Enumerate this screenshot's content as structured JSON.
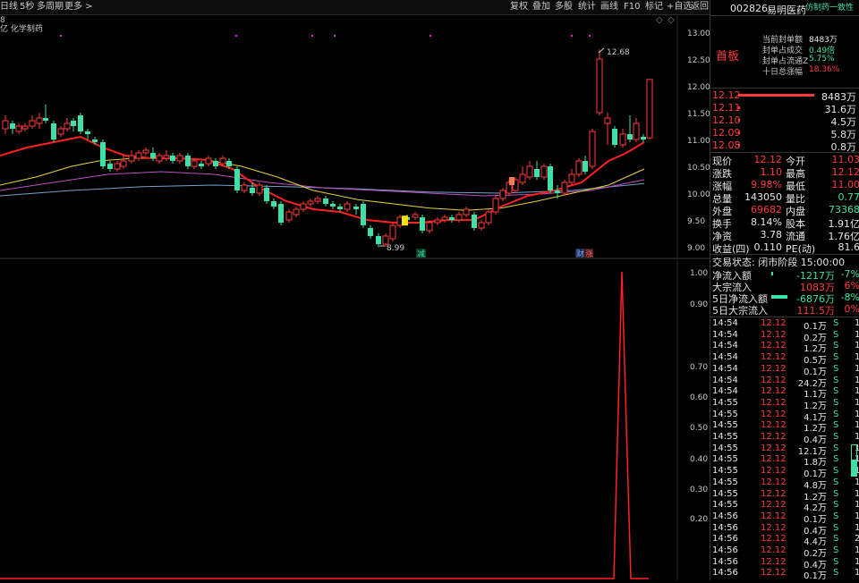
{
  "toolbar": {
    "left": [
      {
        "name": "period-daily",
        "label": "日线"
      },
      {
        "name": "period-5s",
        "label": "5秒"
      },
      {
        "name": "multi-period",
        "label": "多周期"
      },
      {
        "name": "more",
        "label": "更多 >"
      }
    ],
    "right": [
      {
        "name": "restore-rights",
        "label": "复权"
      },
      {
        "name": "overlay",
        "label": "叠加"
      },
      {
        "name": "multi-stock",
        "label": "多股"
      },
      {
        "name": "stats",
        "label": "统计"
      },
      {
        "name": "draw-line",
        "label": "画线"
      },
      {
        "name": "f10",
        "label": "F10"
      },
      {
        "name": "mark",
        "label": "标记"
      },
      {
        "name": "add-watch",
        "label": "+自选"
      },
      {
        "name": "back",
        "label": "返回"
      }
    ]
  },
  "chart": {
    "indicator_num": "8",
    "sector_label": "亿 化学制药",
    "y_labels": [
      "13.00",
      "12.50",
      "12.00",
      "11.50",
      "11.00",
      "10.50",
      "10.00",
      "9.50",
      "9.00"
    ],
    "high_label": "12.68",
    "low_label": "8.99",
    "event_labels": [
      "减",
      "财",
      "涨"
    ],
    "lower_y_labels": [
      "1.00",
      "0.90",
      "0.70",
      "0.60",
      "0.50",
      "0.40",
      "0.30",
      "0.20"
    ]
  },
  "panel": {
    "code": "002826",
    "name": "易明医药",
    "tag": "仿制药一致性",
    "status": "首板",
    "seal_stats": [
      {
        "label": "当前封单额",
        "value": "8483万",
        "color": "white"
      },
      {
        "label": "封单占成交",
        "value": "0.49倍",
        "color": "green"
      },
      {
        "label": "封单占流通Z",
        "value": "5.75%",
        "color": "green"
      },
      {
        "label": "十日总涨幅",
        "value": "18.36%",
        "color": "red"
      }
    ],
    "bids": [
      {
        "price": "12.12",
        "vol": "8483万",
        "bar": 1.0
      },
      {
        "price": "12.11",
        "vol": "31.6万",
        "bar": 0.02
      },
      {
        "price": "12.10",
        "vol": "4.5万",
        "bar": 0.02
      },
      {
        "price": "12.09",
        "vol": "5.8万",
        "bar": 0.02
      },
      {
        "price": "12.08",
        "vol": "0.8万",
        "bar": 0.02
      }
    ],
    "quote_rows": [
      {
        "l1": "现价",
        "v1": "12.12",
        "c1": "red",
        "l2": "今开",
        "v2": "11.03",
        "c2": "red"
      },
      {
        "l1": "涨跌",
        "v1": "1.10",
        "c1": "red",
        "l2": "最高",
        "v2": "12.12",
        "c2": "red"
      },
      {
        "l1": "涨幅",
        "v1": "9.98%",
        "c1": "red",
        "l2": "最低",
        "v2": "11.00",
        "c2": "red"
      },
      {
        "l1": "总量",
        "v1": "143050",
        "c1": "white",
        "l2": "量比",
        "v2": "0.77",
        "c2": "green"
      },
      {
        "l1": "外盘",
        "v1": "69682",
        "c1": "red",
        "l2": "内盘",
        "v2": "73368",
        "c2": "green"
      },
      {
        "l1": "换手",
        "v1": "8.14%",
        "c1": "white",
        "l2": "股本",
        "v2": "1.91亿",
        "c2": "white"
      },
      {
        "l1": "净资",
        "v1": "3.78",
        "c1": "white",
        "l2": "流通",
        "v2": "1.76亿",
        "c2": "white"
      },
      {
        "l1": "收益(四)",
        "v1": "0.110",
        "c1": "white",
        "l2": "PE(动)",
        "v2": "81.6",
        "c2": "white"
      }
    ],
    "trade_status": "交易状态: 闭市阶段 15:00:00",
    "flows": [
      {
        "label": "净流入额",
        "value": "-1217万",
        "pct": "-7%",
        "color": "green",
        "bar": 0.03
      },
      {
        "label": "大宗流入",
        "value": "1083万",
        "pct": "6%",
        "color": "red",
        "bar": 0
      },
      {
        "label": "5日净流入额",
        "value": "-6876万",
        "pct": "-8%",
        "color": "green",
        "bar": 0.9
      },
      {
        "label": "5日大宗流入",
        "value": "111.5万",
        "pct": "0%",
        "color": "red",
        "bar": 0
      }
    ],
    "ticks": [
      {
        "time": "14:54",
        "price": "12.12",
        "vol": "0.1万",
        "side": "S",
        "n": "1"
      },
      {
        "time": "14:54",
        "price": "12.12",
        "vol": "0.2万",
        "side": "S",
        "n": "1"
      },
      {
        "time": "14:54",
        "price": "12.12",
        "vol": "1.2万",
        "side": "S",
        "n": "1"
      },
      {
        "time": "14:54",
        "price": "12.12",
        "vol": "0.5万",
        "side": "S",
        "n": "1"
      },
      {
        "time": "14:54",
        "price": "12.12",
        "vol": "0.1万",
        "side": "S",
        "n": "1"
      },
      {
        "time": "14:54",
        "price": "12.12",
        "vol": "24.2万",
        "side": "S",
        "n": "1"
      },
      {
        "time": "14:54",
        "price": "12.12",
        "vol": "1.1万",
        "side": "S",
        "n": "1"
      },
      {
        "time": "14:55",
        "price": "12.12",
        "vol": "1.2万",
        "side": "S",
        "n": "1"
      },
      {
        "time": "14:55",
        "price": "12.12",
        "vol": "4.1万",
        "side": "S",
        "n": "1"
      },
      {
        "time": "14:55",
        "price": "12.12",
        "vol": "1.2万",
        "side": "S",
        "n": "1"
      },
      {
        "time": "14:55",
        "price": "12.12",
        "vol": "0.4万",
        "side": "S",
        "n": "1"
      },
      {
        "time": "14:55",
        "price": "12.12",
        "vol": "12.1万",
        "side": "S",
        "n": "1"
      },
      {
        "time": "14:55",
        "price": "12.12",
        "vol": "1.8万",
        "side": "S",
        "n": "1"
      },
      {
        "time": "14:55",
        "price": "12.12",
        "vol": "0.1万",
        "side": "S",
        "n": "1"
      },
      {
        "time": "14:55",
        "price": "12.12",
        "vol": "4.8万",
        "side": "S",
        "n": "1"
      },
      {
        "time": "14:55",
        "price": "12.12",
        "vol": "1.2万",
        "side": "S",
        "n": "1"
      },
      {
        "time": "14:55",
        "price": "12.12",
        "vol": "4.2万",
        "side": "S",
        "n": "1"
      },
      {
        "time": "14:56",
        "price": "12.12",
        "vol": "0.1万",
        "side": "S",
        "n": "1"
      },
      {
        "time": "14:56",
        "price": "12.12",
        "vol": "0.4万",
        "side": "S",
        "n": "1"
      },
      {
        "time": "14:56",
        "price": "12.12",
        "vol": "4.4万",
        "side": "S",
        "n": "2"
      },
      {
        "time": "14:56",
        "price": "12.12",
        "vol": "0.2万",
        "side": "S",
        "n": "1"
      },
      {
        "time": "14:56",
        "price": "12.12",
        "vol": "0.4万",
        "side": "S",
        "n": "1"
      },
      {
        "time": "14:56",
        "price": "12.12",
        "vol": "0.1万",
        "side": "S",
        "n": "1"
      }
    ]
  },
  "colors": {
    "up": "#ff3b3b",
    "down": "#3ee0a8",
    "ma_red": "#ff2020",
    "ma_yellow": "#e8d23a",
    "ma_magenta": "#c050c0",
    "ma_blue": "#70a0d0"
  }
}
